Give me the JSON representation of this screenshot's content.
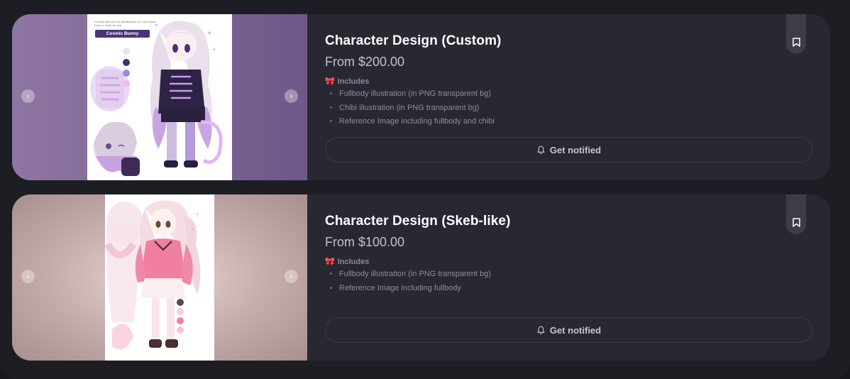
{
  "listings": [
    {
      "title": "Character Design (Custom)",
      "price": "From $200.00",
      "includes_label": "Includes",
      "items": [
        "Fullbody illustration (in PNG transparent bg)",
        "Chibi illustration (in PNG transparent bg)",
        "Reference Image including fullbody and chibi"
      ],
      "button_label": "Get notified",
      "artwork_banner": "Cosmic Bunny",
      "artwork_watermark": "Created with love by @kailintbest. Do not redraw, trace or resell as own.",
      "palette": [
        "#e8e8e8",
        "#4a2a66",
        "#9b87d9",
        "#f3b8ef"
      ]
    },
    {
      "title": "Character Design (Skeb-like)",
      "price": "From $100.00",
      "includes_label": "Includes",
      "items": [
        "Fullbody illustration (in PNG transparent bg)",
        "Reference Image including fullbody"
      ],
      "button_label": "Get notified",
      "palette": [
        "#5a4a4a",
        "#f2d2d8",
        "#f07fa0",
        "#f8c2cf"
      ]
    }
  ],
  "colors": {
    "background": "#1d1d24",
    "card": "#282833",
    "accent_ribbon": "#b8406e"
  },
  "icons": {
    "prev": "chevron-left-icon",
    "next": "chevron-right-icon",
    "bell": "bell-icon",
    "bookmark": "bookmark-icon",
    "ribbon": "ribbon-icon"
  }
}
